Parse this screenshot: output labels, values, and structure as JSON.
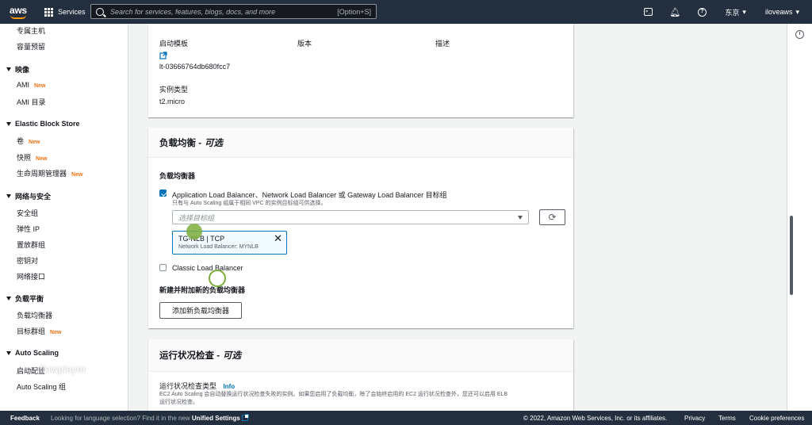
{
  "nav": {
    "logo": "aws",
    "services": "Services",
    "search_placeholder": "Search for services, features, blogs, docs, and more",
    "search_hint": "[Option+S]",
    "region": "东京",
    "account": "iloveaws"
  },
  "sidebar": {
    "items_top": [
      "专属主机",
      "容量预留"
    ],
    "sections": [
      {
        "title": "映像",
        "items": [
          {
            "label": "AMI",
            "badge": "New"
          },
          {
            "label": "AMI 目录",
            "badge": ""
          }
        ]
      },
      {
        "title": "Elastic Block Store",
        "items": [
          {
            "label": "卷",
            "badge": "New"
          },
          {
            "label": "快照",
            "badge": "New"
          },
          {
            "label": "生命周期管理器",
            "badge": "New"
          }
        ]
      },
      {
        "title": "网络与安全",
        "items": [
          {
            "label": "安全组",
            "badge": ""
          },
          {
            "label": "弹性 IP",
            "badge": ""
          },
          {
            "label": "置放群组",
            "badge": ""
          },
          {
            "label": "密钥对",
            "badge": ""
          },
          {
            "label": "网络接口",
            "badge": ""
          }
        ]
      },
      {
        "title": "负载平衡",
        "items": [
          {
            "label": "负载均衡器",
            "badge": ""
          },
          {
            "label": "目标群组",
            "badge": "New"
          }
        ]
      },
      {
        "title": "Auto Scaling",
        "items": [
          {
            "label": "启动配置",
            "badge": ""
          },
          {
            "label": "Auto Scaling 组",
            "badge": ""
          }
        ]
      }
    ]
  },
  "template_panel": {
    "col1_label": "启动模板",
    "col2_label": "版本",
    "col3_label": "描述",
    "template_id": "lt-03666764db680fcc7",
    "instance_type_label": "实例类型",
    "instance_type": "t2.micro"
  },
  "lb_panel": {
    "title": "负载均衡 -",
    "title_optional": "可选",
    "section_label": "负载均衡器",
    "alb_label": "Application Load Balancer、Network Load Balancer 或 Gateway Load Balancer 目标组",
    "alb_sub": "只有与 Auto Scaling 组属于相同 VPC 的实例目标组可供选择。",
    "select_placeholder": "选择目标组",
    "token_title": "TG-NLB | TCP",
    "token_sub": "Network Load Balancer: MYNLB",
    "classic_label": "Classic Load Balancer",
    "new_lb_label": "新建并附加新的负载均衡器",
    "add_button": "添加新负载均衡器"
  },
  "health_panel": {
    "title": "运行状况检查 -",
    "title_optional": "可选",
    "type_label": "运行状况检查类型",
    "info": "Info",
    "desc_line1": "EC2 Auto Scaling 会自动替换运行状况检查失败的实例。如果您启用了负载均衡，除了会始终启用的 EC2 运行状况检查外，您还可以启用 ELB",
    "desc_line2": "运行状况检查。"
  },
  "watermark": "flowplayer",
  "footer": {
    "feedback": "Feedback",
    "lang_text": "Looking for language selection? Find it in the new",
    "unified": "Unified Settings",
    "copyright": "© 2022, Amazon Web Services, Inc. or its affiliates.",
    "privacy": "Privacy",
    "terms": "Terms",
    "cookies": "Cookie preferences"
  },
  "colors": {
    "nav": "#232f3e",
    "accent": "#0073bb",
    "badge": "#ec7211",
    "cursor": "#7cad3b"
  }
}
